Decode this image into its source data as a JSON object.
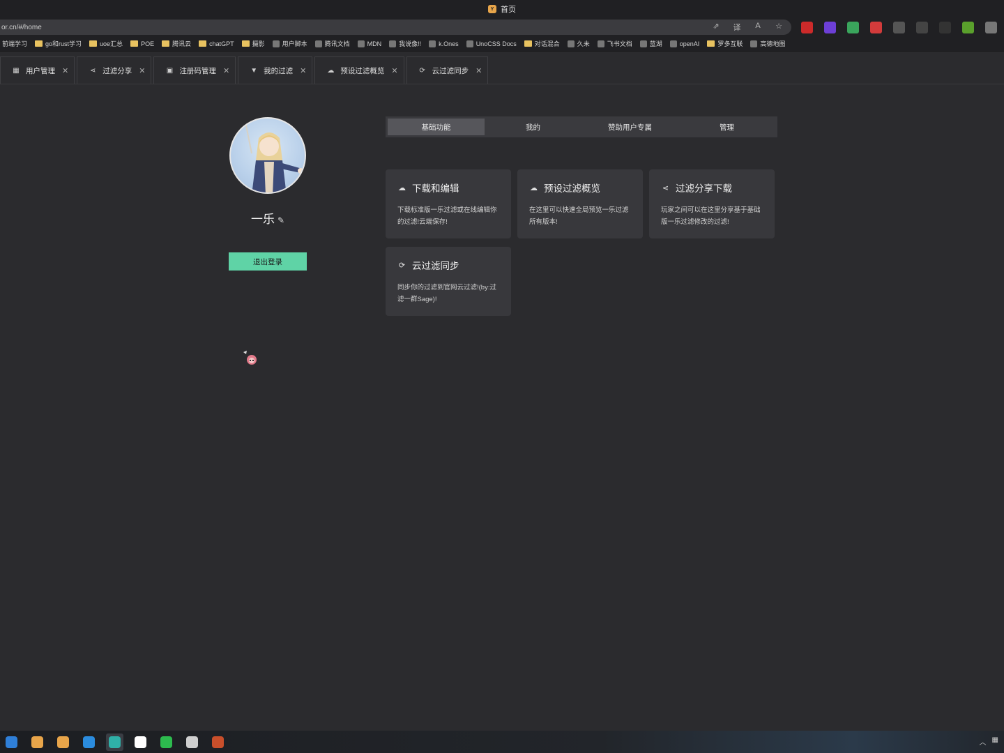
{
  "window": {
    "title": "首页",
    "app_icon": "Y"
  },
  "browser": {
    "url": "or.cn/#/home",
    "url_actions": [
      "open-external-icon",
      "translate-icon",
      "read-aloud-icon",
      "favorite-star-icon"
    ],
    "extensions": [
      {
        "icon": "ext-gamepad-icon",
        "color": "#cc2a2a"
      },
      {
        "icon": "ext-purple-icon",
        "color": "#6d3fd6"
      },
      {
        "icon": "ext-shield-icon",
        "color": "#3aa55c"
      },
      {
        "icon": "ext-red-icon",
        "color": "#d23b3b"
      },
      {
        "icon": "ext-a-icon",
        "color": "#555555"
      },
      {
        "icon": "ext-arrow-icon",
        "color": "#444444"
      },
      {
        "icon": "ext-box-icon",
        "color": "#333333"
      },
      {
        "icon": "ext-leaf-icon",
        "color": "#5aa02c"
      },
      {
        "icon": "extensions-puzzle-icon",
        "color": "#777777"
      }
    ]
  },
  "bookmarks": [
    {
      "label": "前端学习",
      "type": "text"
    },
    {
      "label": "go和rust学习",
      "type": "folder"
    },
    {
      "label": "uoe汇总",
      "type": "folder"
    },
    {
      "label": "POE",
      "type": "folder"
    },
    {
      "label": "腾讯云",
      "type": "folder"
    },
    {
      "label": "chatGPT",
      "type": "folder"
    },
    {
      "label": "摄影",
      "type": "folder"
    },
    {
      "label": "用户脚本",
      "type": "site"
    },
    {
      "label": "腾讯文档",
      "type": "site"
    },
    {
      "label": "MDN",
      "type": "site"
    },
    {
      "label": "我说像!!",
      "type": "site"
    },
    {
      "label": "k.Ones",
      "type": "site"
    },
    {
      "label": "UnoCSS Docs",
      "type": "site"
    },
    {
      "label": "对话混合",
      "type": "folder"
    },
    {
      "label": "久未",
      "type": "site"
    },
    {
      "label": "飞书文档",
      "type": "site"
    },
    {
      "label": "蓝湖",
      "type": "site"
    },
    {
      "label": "openAI",
      "type": "site"
    },
    {
      "label": "罗多互联",
      "type": "folder"
    },
    {
      "label": "高德地图",
      "type": "site"
    }
  ],
  "tabs": [
    {
      "label": "用户管理",
      "icon": "grid-icon"
    },
    {
      "label": "过滤分享",
      "icon": "share-icon"
    },
    {
      "label": "注册码管理",
      "icon": "document-icon"
    },
    {
      "label": "我的过滤",
      "icon": "filter-icon"
    },
    {
      "label": "预设过滤概览",
      "icon": "cloud-icon"
    },
    {
      "label": "云过滤同步",
      "icon": "sync-icon"
    }
  ],
  "profile": {
    "name": "一乐",
    "logout_label": "退出登录"
  },
  "segnav": [
    {
      "label": "基础功能",
      "active": true
    },
    {
      "label": "我的",
      "active": false
    },
    {
      "label": "赞助用户专属",
      "active": false
    },
    {
      "label": "管理",
      "active": false
    }
  ],
  "cards": [
    {
      "title": "下载和编辑",
      "icon": "cloud-upload-icon",
      "desc": "下载标准版一乐过滤或在线编辑你的过滤!云端保存!"
    },
    {
      "title": "预设过滤概览",
      "icon": "cloud-icon",
      "desc": "在这里可以快速全局预览一乐过滤所有版本!"
    },
    {
      "title": "过滤分享下载",
      "icon": "share-icon",
      "desc": "玩家之间可以在这里分享基于基础版一乐过滤修改的过滤!"
    },
    {
      "title": "云过滤同步",
      "icon": "sync-icon",
      "desc": "同步你的过滤到官网云过滤!(by:过滤一群Sage)!"
    }
  ],
  "taskbar": [
    {
      "icon": "shield-app-icon",
      "color": "#2f7fd8"
    },
    {
      "icon": "yuque-app-icon",
      "color": "#e8a54a"
    },
    {
      "icon": "yuque-app-icon-2",
      "color": "#e8a54a"
    },
    {
      "icon": "vscode-icon",
      "color": "#2b8cde"
    },
    {
      "icon": "edge-browser-icon",
      "color": "#2fb0a8",
      "active": true
    },
    {
      "icon": "qq-icon",
      "color": "#ffffff"
    },
    {
      "icon": "wechat-icon",
      "color": "#2dbb4e"
    },
    {
      "icon": "steam-icon",
      "color": "#cfcfcf"
    },
    {
      "icon": "game-app-icon",
      "color": "#c94f2b"
    }
  ]
}
